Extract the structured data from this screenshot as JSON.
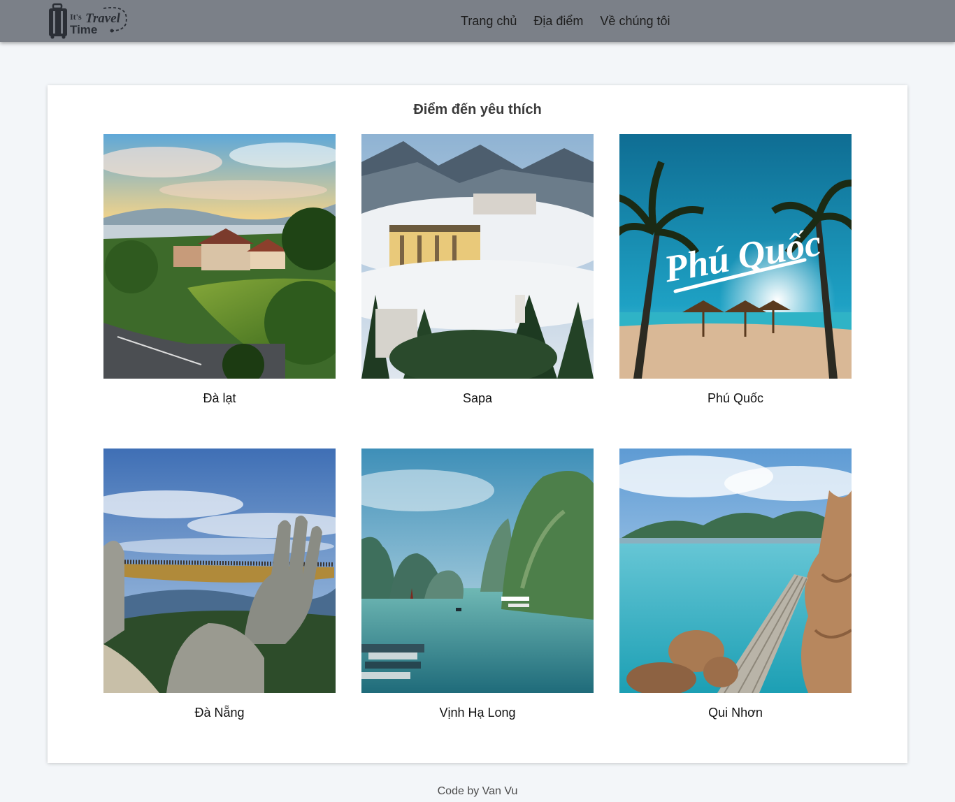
{
  "header": {
    "logo": {
      "line1": "It's",
      "line2": "Travel",
      "line3": "Time",
      "icon": "suitcase-icon"
    },
    "nav": [
      {
        "label": "Trang chủ"
      },
      {
        "label": "Địa điểm"
      },
      {
        "label": "Về chúng tôi"
      }
    ]
  },
  "main": {
    "title": "Điểm đến yêu thích",
    "destinations": [
      {
        "name": "Đà lạt",
        "image": "dalat-photo"
      },
      {
        "name": "Sapa",
        "image": "sapa-photo"
      },
      {
        "name": "Phú Quốc",
        "image": "phuquoc-photo",
        "overlay_text": "Phú Quốc"
      },
      {
        "name": "Đà Nẵng",
        "image": "danang-photo"
      },
      {
        "name": "Vịnh Hạ Long",
        "image": "halong-photo"
      },
      {
        "name": "Qui Nhơn",
        "image": "quinhon-photo"
      }
    ]
  },
  "footer": {
    "text": "Code by Van Vu"
  },
  "colors": {
    "navbar": "#7b8088",
    "background": "#f3f6f9",
    "card": "#ffffff"
  }
}
